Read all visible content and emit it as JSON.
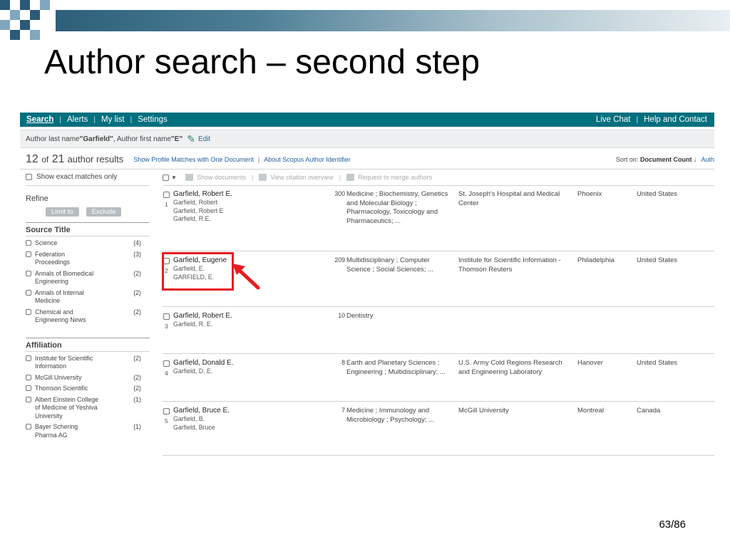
{
  "slide": {
    "title": "Author search – second step",
    "page_number": "63/86",
    "colors": {
      "accent": "#2e5f7a",
      "square_dark": "#2b5a78",
      "square_light": "#7fa7bd",
      "nav": "#006f7e",
      "highlight": "#e81c23"
    }
  },
  "screenshot": {
    "nav": {
      "left_items": [
        "Search",
        "Alerts",
        "My list",
        "Settings"
      ],
      "right_items": [
        "Live Chat",
        "Help and Contact"
      ]
    },
    "query": {
      "prefix": "Author last name ",
      "last_name": "\"Garfield\"",
      "middle": " , Author first name ",
      "first_name": "\"E\"",
      "edit_label": "Edit",
      "edit_icon": "edit-pen-icon"
    },
    "results_header": {
      "shown": "12",
      "of": "of",
      "total": "21",
      "suffix": "author results",
      "link1": "Show Profile Matches with One Document",
      "separator": "|",
      "link2": "About Scopus Author Identifier",
      "sort_label": "Sort on:",
      "sort_value": "Document Count",
      "sort_arrow": "↓",
      "cut_label": "Auth"
    },
    "sidebar": {
      "exact_matches": "Show exact matches only",
      "refine": "Refine",
      "limit_to": "Limit to",
      "exclude": "Exclude",
      "source_title": {
        "heading": "Source Title",
        "items": [
          {
            "name": "Science",
            "count": "(4)"
          },
          {
            "name": "Federation Proceedings",
            "count": "(3)"
          },
          {
            "name": "Annals of Biomedical Engineering",
            "count": "(2)"
          },
          {
            "name": "Annals of Internal Medicine",
            "count": "(2)"
          },
          {
            "name": "Chemical and Engineering News",
            "count": "(2)"
          }
        ]
      },
      "affiliation": {
        "heading": "Affiliation",
        "items": [
          {
            "name": "Institute for Scientific Information",
            "count": "(2)"
          },
          {
            "name": "McGill University",
            "count": "(2)"
          },
          {
            "name": "Thomson Scientific",
            "count": "(2)"
          },
          {
            "name": "Albert Einstein College of Medicine of Yeshiva University",
            "count": "(1)"
          },
          {
            "name": "Bayer Schering Pharma AG",
            "count": "(1)"
          }
        ]
      }
    },
    "toolbar": {
      "show_documents": "Show documents",
      "view_citation": "View citation overview",
      "separator": "|",
      "request_merge": "Request to merge authors"
    },
    "rows": [
      {
        "num": "1",
        "name": "Garfield, Robert E.",
        "variants": [
          "Garfield, Robert",
          "Garfield, Robert E",
          "Garfield, R.E."
        ],
        "docs": "300",
        "subjects": "Medicine ; Biochemistry, Genetics and Molecular Biology ; Pharmacology, Toxicology and Pharmaceutics; ...",
        "affiliation": "St. Joseph's Hospital and Medical Center",
        "city": "Phoenix",
        "country": "United States"
      },
      {
        "num": "2",
        "name": "Garfield, Eugene",
        "variants": [
          "Garfield, E.",
          "GARFIELD, E."
        ],
        "docs": "209",
        "subjects": "Multidisciplinary ; Computer Science ; Social Sciences; ...",
        "affiliation": "Institute for Scientific Information - Thomson Reuters",
        "city": "Philadelphia",
        "country": "United States"
      },
      {
        "num": "3",
        "name": "Garfield, Robert E.",
        "variants": [
          "Garfield, R. E."
        ],
        "docs": "10",
        "subjects": "Dentistry",
        "affiliation": "",
        "city": "",
        "country": ""
      },
      {
        "num": "4",
        "name": "Garfield, Donald E.",
        "variants": [
          "Garfield, D. E."
        ],
        "docs": "8",
        "subjects": "Earth and Planetary Sciences ; Engineering ; Multidisciplinary; ...",
        "affiliation": "U.S. Army Cold Regions Research and Engineering Laboratory",
        "city": "Hanover",
        "country": "United States"
      },
      {
        "num": "5",
        "name": "Garfield, Bruce E.",
        "variants": [
          "Garfield, B.",
          "Garfield, Bruce"
        ],
        "docs": "7",
        "subjects": "Medicine ; Immunology and Microbiology ; Psychology; ...",
        "affiliation": "McGill University",
        "city": "Montreal",
        "country": "Canada"
      }
    ]
  }
}
